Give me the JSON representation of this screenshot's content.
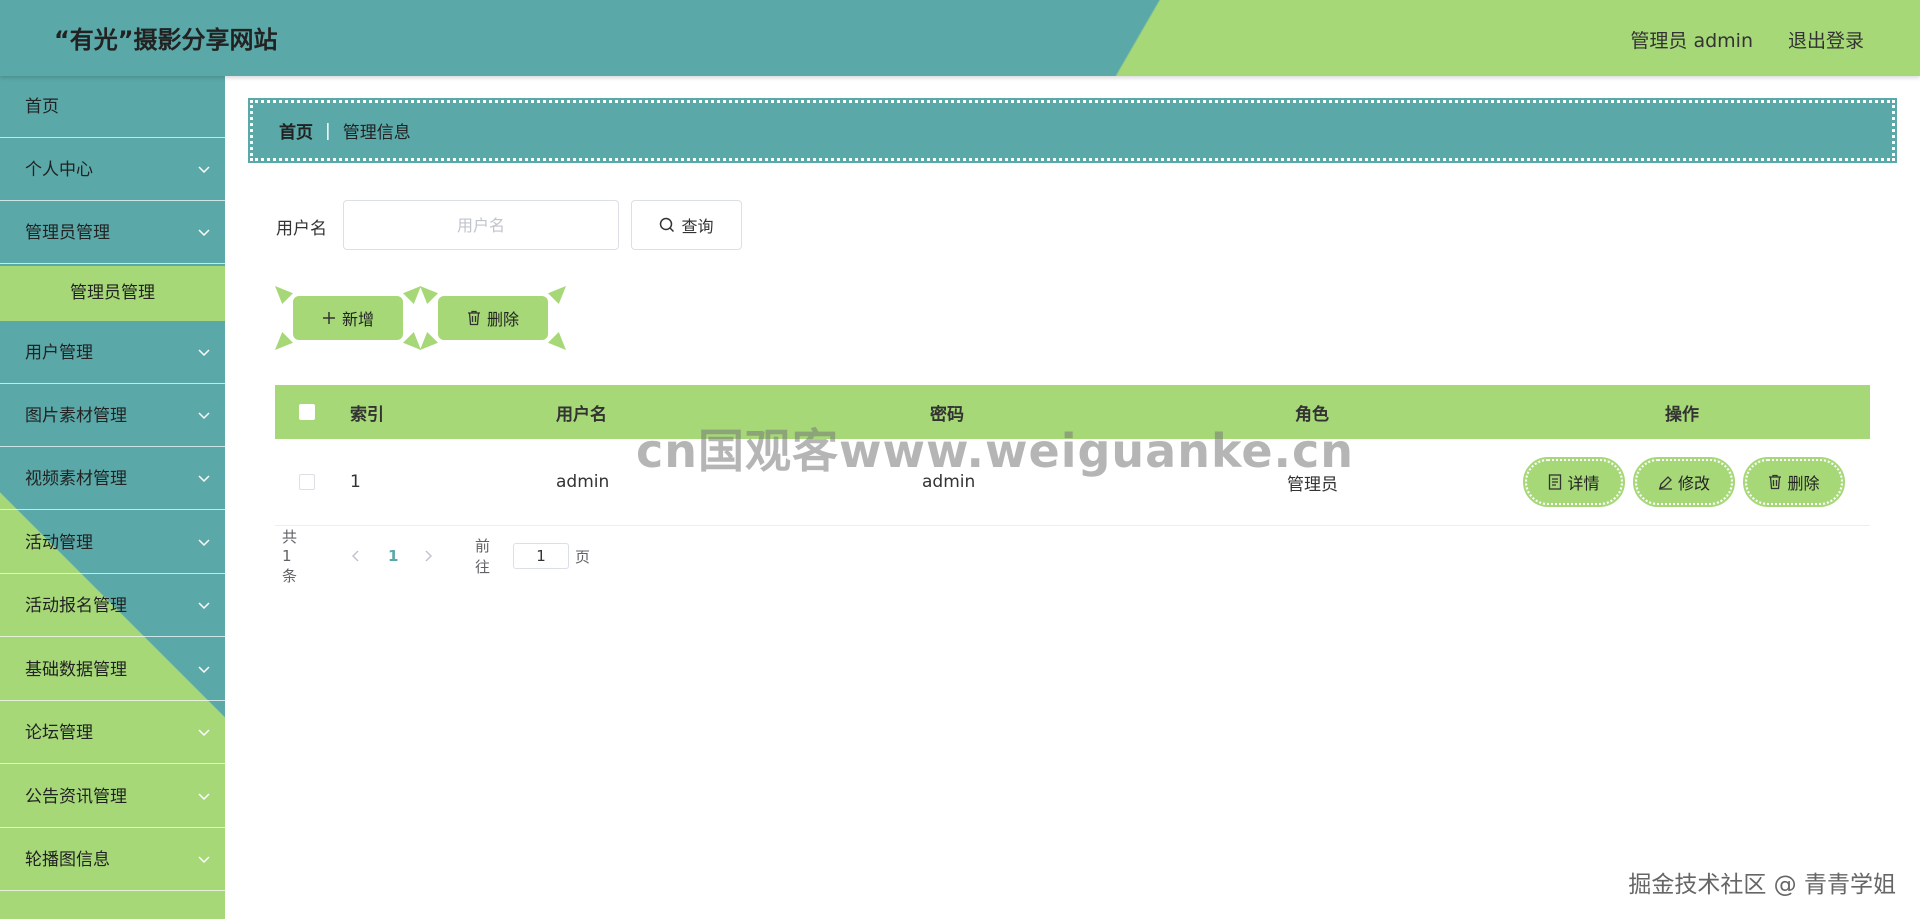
{
  "header": {
    "title": "“有光”摄影分享网站",
    "user": "管理员 admin",
    "logout": "退出登录"
  },
  "sidebar": {
    "items": [
      {
        "label": "首页",
        "chevron": false
      },
      {
        "label": "个人中心",
        "chevron": true
      },
      {
        "label": "管理员管理",
        "chevron": true
      },
      {
        "label": "用户管理",
        "chevron": true
      },
      {
        "label": "图片素材管理",
        "chevron": true
      },
      {
        "label": "视频素材管理",
        "chevron": true
      },
      {
        "label": "活动管理",
        "chevron": true
      },
      {
        "label": "活动报名管理",
        "chevron": true
      },
      {
        "label": "基础数据管理",
        "chevron": true
      },
      {
        "label": "论坛管理",
        "chevron": true
      },
      {
        "label": "公告资讯管理",
        "chevron": true
      },
      {
        "label": "轮播图信息",
        "chevron": true
      }
    ],
    "active_sub": "管理员管理"
  },
  "breadcrumb": {
    "home": "首页",
    "separator": "|",
    "current": "管理信息"
  },
  "search": {
    "label": "用户名",
    "placeholder": "用户名",
    "value": "",
    "button": "查询"
  },
  "actions": {
    "add": "新增",
    "delete": "删除"
  },
  "table": {
    "columns": [
      "索引",
      "用户名",
      "密码",
      "角色",
      "操作"
    ],
    "rows": [
      {
        "index": "1",
        "username": "admin",
        "password": "admin",
        "role": "管理员"
      }
    ],
    "row_actions": {
      "detail": "详情",
      "edit": "修改",
      "delete": "删除"
    }
  },
  "pagination": {
    "total": "共 1 条",
    "current_page": "1",
    "goto_label": "前往",
    "goto_value": "1",
    "page_suffix": "页"
  },
  "watermark": "cn国观客www.weiguanke.cn",
  "footer_mark": "掘金技术社区 @ 青青学姐",
  "colors": {
    "teal": "#5ba8a8",
    "green": "#a6d878"
  }
}
